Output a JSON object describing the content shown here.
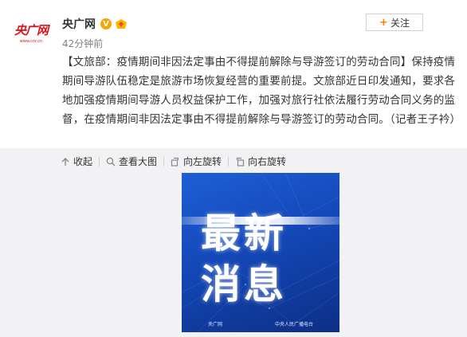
{
  "account": {
    "logo_text": "央广网",
    "logo_sub": "www.cnr.cn",
    "name": "央广网",
    "verified_badge": "V",
    "time": "42分钟前",
    "follow_label": "关注",
    "follow_icon": "plus-icon",
    "accent_color": "#ff8200"
  },
  "post": {
    "text": "【文旅部：疫情期间非因法定事由不得提前解除与导游签订的劳动合同】保持疫情期间导游队伍稳定是旅游市场恢复经营的重要前提。文旅部近日印发通知，要求各地加强疫情期间导游人员权益保护工作，加强对旅行社依法履行劳动合同义务的监督，在疫情期间非因法定事由不得提前解除与导游签订的劳动合同。（记者王子衿）"
  },
  "toolbar": {
    "collapse_label": "收起",
    "view_large_label": "查看大图",
    "rotate_left_label": "向左旋转",
    "rotate_right_label": "向右旋转"
  },
  "image": {
    "line1": "最新",
    "line2": "消息",
    "footer_left": "央广网",
    "footer_right": "中央人民广播电台"
  }
}
